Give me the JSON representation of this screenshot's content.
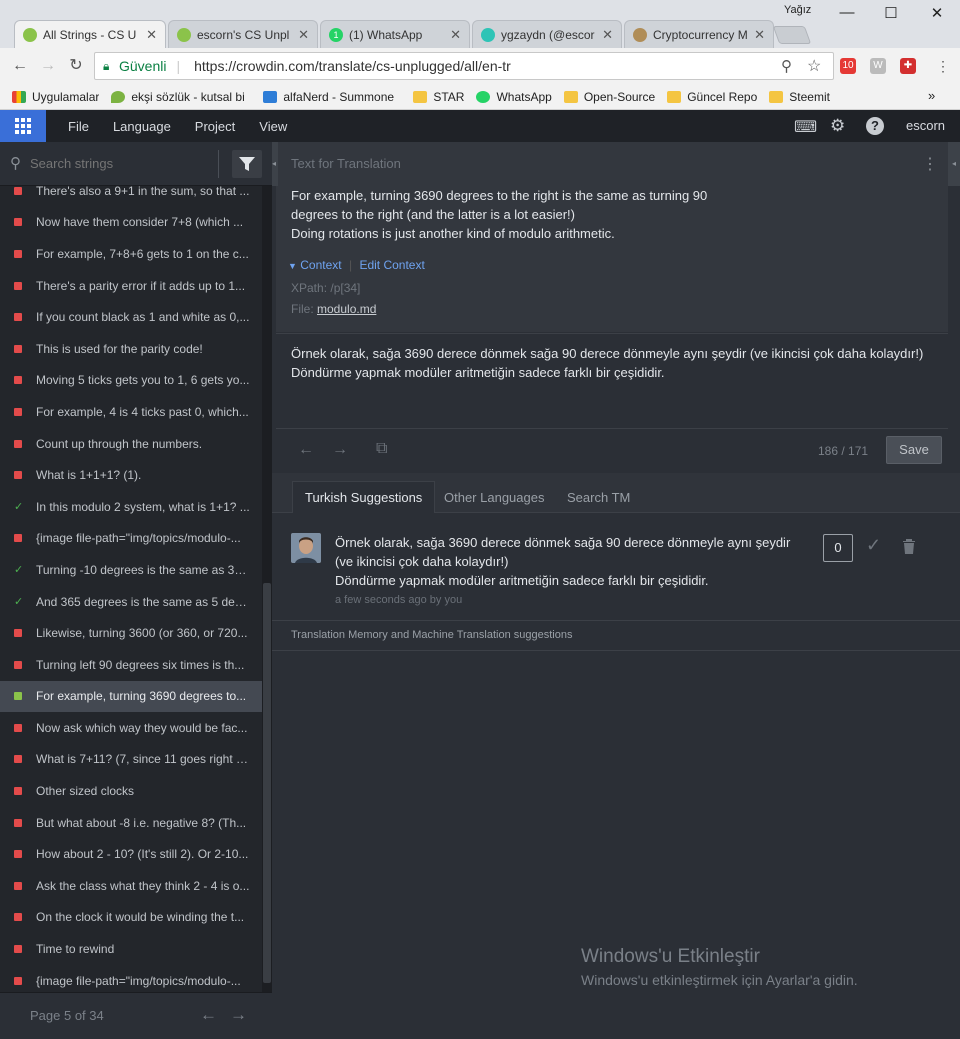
{
  "browser": {
    "user": "Yağız",
    "tabs": [
      {
        "title": "All Strings - CS U",
        "color": "#8bc34a"
      },
      {
        "title": "escorn's CS Unpl",
        "color": "#8bc34a"
      },
      {
        "title": "(1) WhatsApp",
        "color": "#25d366",
        "badge": "1"
      },
      {
        "title": "ygzaydn (@escor",
        "color": "#2ec4b6"
      },
      {
        "title": "Cryptocurrency M",
        "color": "#b08d57"
      }
    ],
    "secure_label": "Güvenli",
    "url": "https://crowdin.com/translate/cs-unplugged/all/en-tr",
    "ext_badge": "10",
    "bookmarks": [
      {
        "label": "Uygulamalar",
        "color": "#e94235"
      },
      {
        "label": "ekşi sözlük - kutsal bi",
        "color": "#7cb342"
      },
      {
        "label": "alfaNerd - Summone",
        "color": "#2e7dd7"
      },
      {
        "label": "STAR",
        "color": "#f4c542"
      },
      {
        "label": "WhatsApp",
        "color": "#25d366"
      },
      {
        "label": "Open-Source",
        "color": "#f4c542"
      },
      {
        "label": "Güncel Repo",
        "color": "#f4c542"
      },
      {
        "label": "Steemit",
        "color": "#f4c542"
      }
    ],
    "bookmarks_more": "»"
  },
  "appbar": {
    "menus": [
      "File",
      "Language",
      "Project",
      "View"
    ],
    "username": "escorn"
  },
  "sidebar": {
    "search_placeholder": "Search strings",
    "strings": [
      {
        "text": "There's also a 9+1 in the sum, so that ...",
        "status": "untranslated"
      },
      {
        "text": "Now have them consider 7+8 (which ...",
        "status": "untranslated"
      },
      {
        "text": "For example, 7+8+6 gets to 1 on the c...",
        "status": "untranslated"
      },
      {
        "text": "There's a parity error if it adds up to 1...",
        "status": "untranslated"
      },
      {
        "text": "If you count black as 1 and white as 0,...",
        "status": "untranslated"
      },
      {
        "text": "This is used for the parity code!",
        "status": "untranslated"
      },
      {
        "text": "Moving 5 ticks gets you to 1, 6 gets yo...",
        "status": "untranslated"
      },
      {
        "text": "For example, 4 is 4 ticks past 0, which...",
        "status": "untranslated"
      },
      {
        "text": "Count up through the numbers.",
        "status": "untranslated"
      },
      {
        "text": "What is 1+1+1? (1).",
        "status": "untranslated"
      },
      {
        "text": "In this modulo 2 system, what is 1+1? ...",
        "status": "approved"
      },
      {
        "text": "{image file-path=\"img/topics/modulo-...",
        "status": "untranslated"
      },
      {
        "text": "Turning -10 degrees is the same as 35...",
        "status": "approved"
      },
      {
        "text": "And 365 degrees is the same as 5 deg...",
        "status": "approved"
      },
      {
        "text": "Likewise, turning 3600 (or 360, or 720...",
        "status": "untranslated"
      },
      {
        "text": "Turning left 90 degrees six times is th...",
        "status": "untranslated"
      },
      {
        "text": "For example, turning 3690 degrees to...",
        "status": "translated",
        "selected": true
      },
      {
        "text": "Now ask which way they would be fac...",
        "status": "untranslated"
      },
      {
        "text": "What is 7+11? (7, since 11 goes right a...",
        "status": "untranslated"
      },
      {
        "text": "Other sized clocks",
        "status": "untranslated"
      },
      {
        "text": "But what about -8 i.e. negative 8? (Th...",
        "status": "untranslated"
      },
      {
        "text": "How about 2 - 10? (It's still 2). Or 2-10...",
        "status": "untranslated"
      },
      {
        "text": "Ask the class what they think 2 - 4 is o...",
        "status": "untranslated"
      },
      {
        "text": "On the clock it would be winding the t...",
        "status": "untranslated"
      },
      {
        "text": "Time to rewind",
        "status": "untranslated"
      },
      {
        "text": "{image file-path=\"img/topics/modulo-...",
        "status": "untranslated"
      }
    ],
    "page_label": "Page 5 of 34"
  },
  "source": {
    "header": "Text for Translation",
    "lines": [
      "For example, turning 3690 degrees to the right is the same as turning 90",
      "degrees to the right (and the latter is a lot easier!)",
      "Doing rotations is just another kind of modulo arithmetic."
    ],
    "context_label": "Context",
    "edit_context_label": "Edit Context",
    "xpath": "XPath: /p[34]",
    "file_label": "File:",
    "file_name": "modulo.md"
  },
  "translation": {
    "lines": [
      "Örnek olarak, sağa 3690 derece dönmek sağa 90 derece dönmeyle aynı şeydir (ve ikincisi çok daha kolaydır!)",
      "Döndürme yapmak modüler aritmetiğin sadece farklı bir çeşididir."
    ],
    "counter": "186 / 171",
    "save_label": "Save"
  },
  "suggestions": {
    "tabs": [
      "Turkish Suggestions",
      "Other Languages",
      "Search TM"
    ],
    "items": [
      {
        "lines": [
          "Örnek olarak, sağa 3690 derece dönmek sağa 90 derece dönmeyle aynı şeydir",
          "(ve ikincisi çok daha kolaydır!)",
          "Döndürme yapmak modüler aritmetiğin sadece farklı bir çeşididir."
        ],
        "meta": "a few seconds ago by you",
        "votes": "0"
      }
    ],
    "tm_header": "Translation Memory and Machine Translation suggestions"
  },
  "watermark": {
    "title": "Windows'u Etkinleştir",
    "subtitle": "Windows'u etkinleştirmek için Ayarlar'a gidin."
  },
  "colors": {
    "accent": "#3a6fd8",
    "untranslated": "#e34b4b",
    "approved": "#4caf50",
    "translated": "#8bc34a"
  }
}
